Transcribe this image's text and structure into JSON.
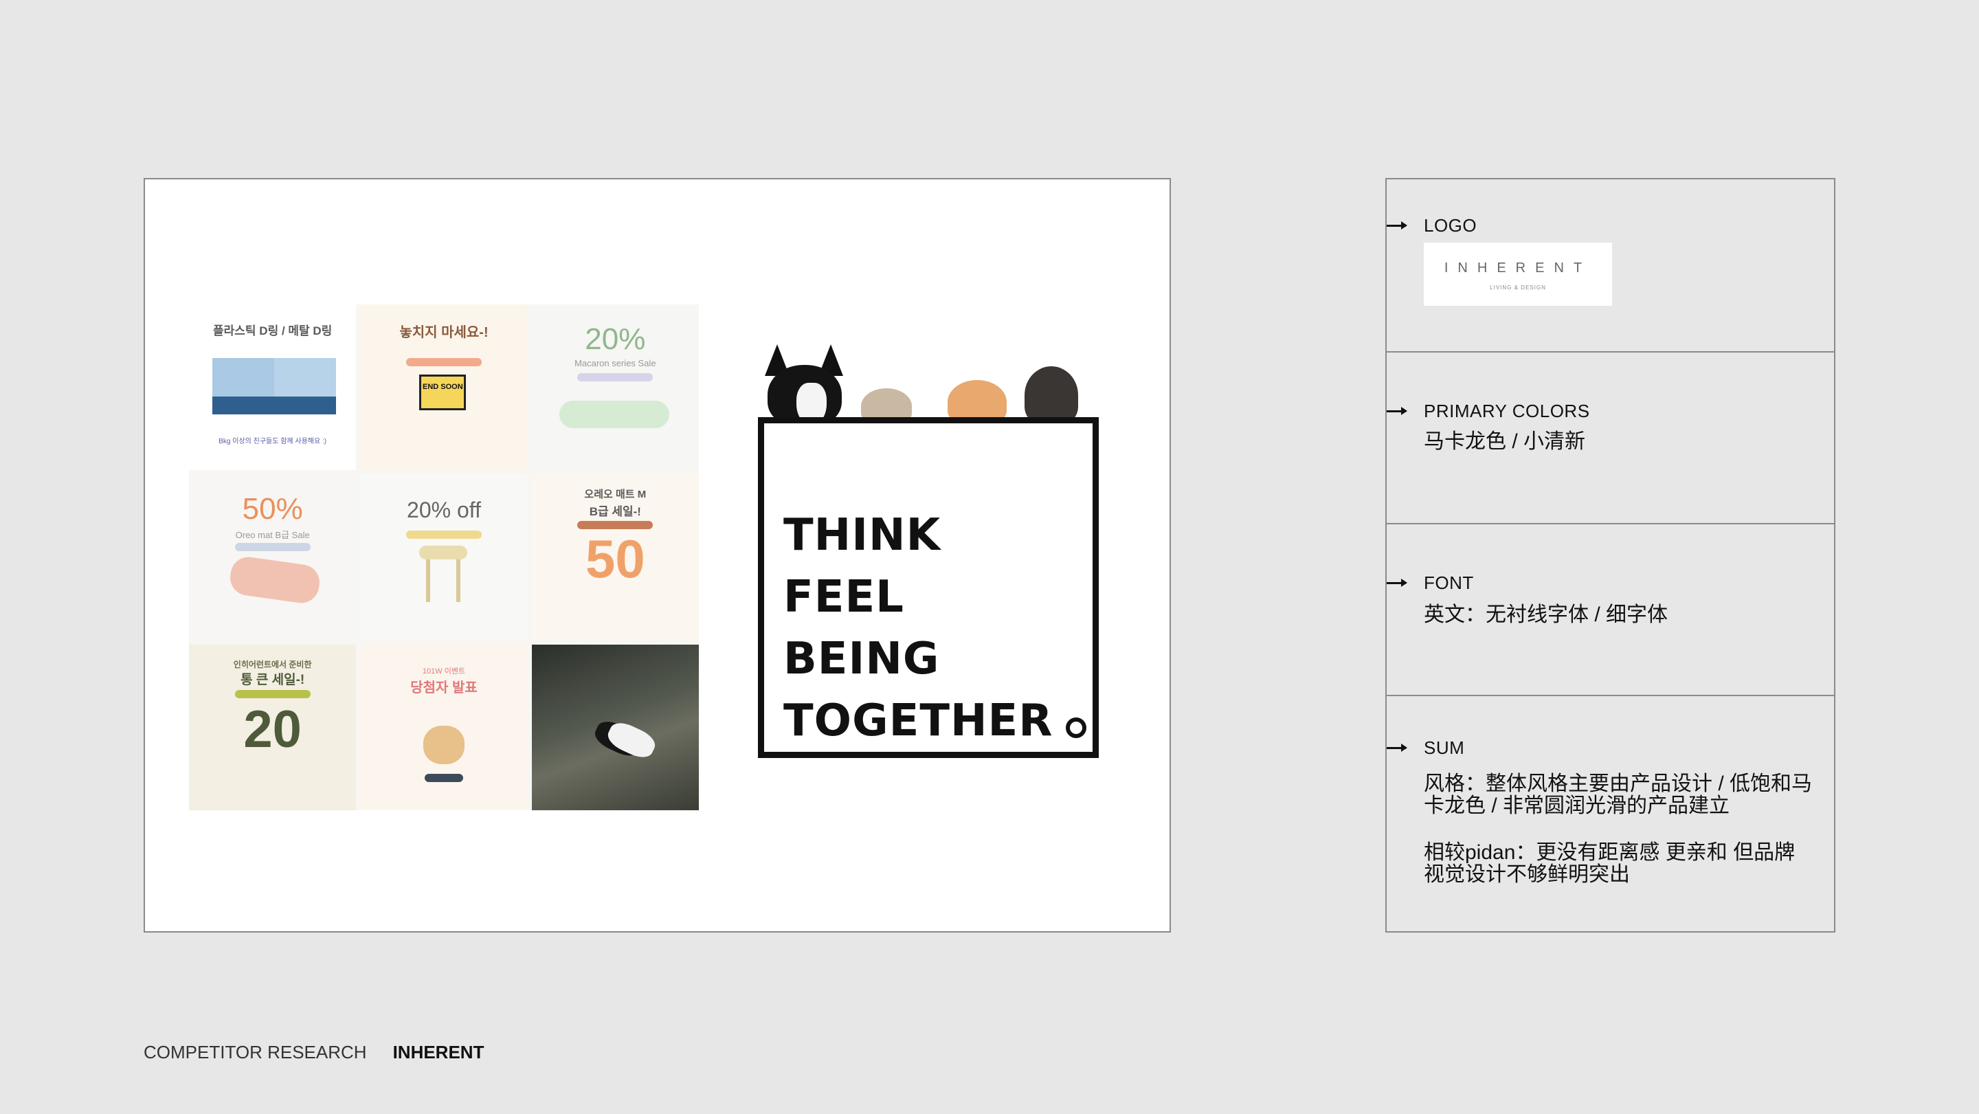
{
  "showcase": {
    "tiles": [
      {
        "title": "플라스틱 D링 / 메탈 D링",
        "caption": "Bkg 이상의 친구들도 함께 사용해요 :)"
      },
      {
        "title": "놓치지 마세요-!",
        "badge": "END SOON"
      },
      {
        "big": "20%",
        "sub": "Macaron series Sale"
      },
      {
        "big": "50%",
        "sub": "Oreo mat B급 Sale"
      },
      {
        "big": "20% off",
        "sub": ""
      },
      {
        "title": "오레오 매트 M",
        "sub": "B급 세일-!",
        "big": "50"
      },
      {
        "title": "인히어런트에서 준비한",
        "sub": "통 큰 세일-!",
        "big": "20"
      },
      {
        "title": "101W 이벤트",
        "sub": "당첨자 발표"
      },
      {
        "photo": "dog-walking-photo"
      }
    ],
    "poster": {
      "lines": [
        "THINK",
        "FEEL",
        "BEING",
        "TOGETHER"
      ]
    }
  },
  "panel": {
    "logo": {
      "title": "LOGO",
      "brand": "INHERENT",
      "tagline": "LIVING & DESIGN"
    },
    "colors": {
      "title": "PRIMARY COLORS",
      "text": "马卡龙色 / 小清新"
    },
    "font": {
      "title": "FONT",
      "text": "英文：无衬线字体 / 细字体"
    },
    "sum": {
      "title": "SUM",
      "text1": "风格：整体风格主要由产品设计 / 低饱和马卡龙色 / 非常圆润光滑的产品建立",
      "text2": "相较pidan：更没有距离感 更亲和 但品牌视觉设计不够鲜明突出"
    }
  },
  "footer": {
    "label": "COMPETITOR RESEARCH",
    "brand": "INHERENT"
  },
  "colors": {
    "background": "#e7e7e7",
    "accent_green": "#8fb78c",
    "accent_orange": "#e9915a",
    "accent_pink": "#f1c2b2"
  }
}
